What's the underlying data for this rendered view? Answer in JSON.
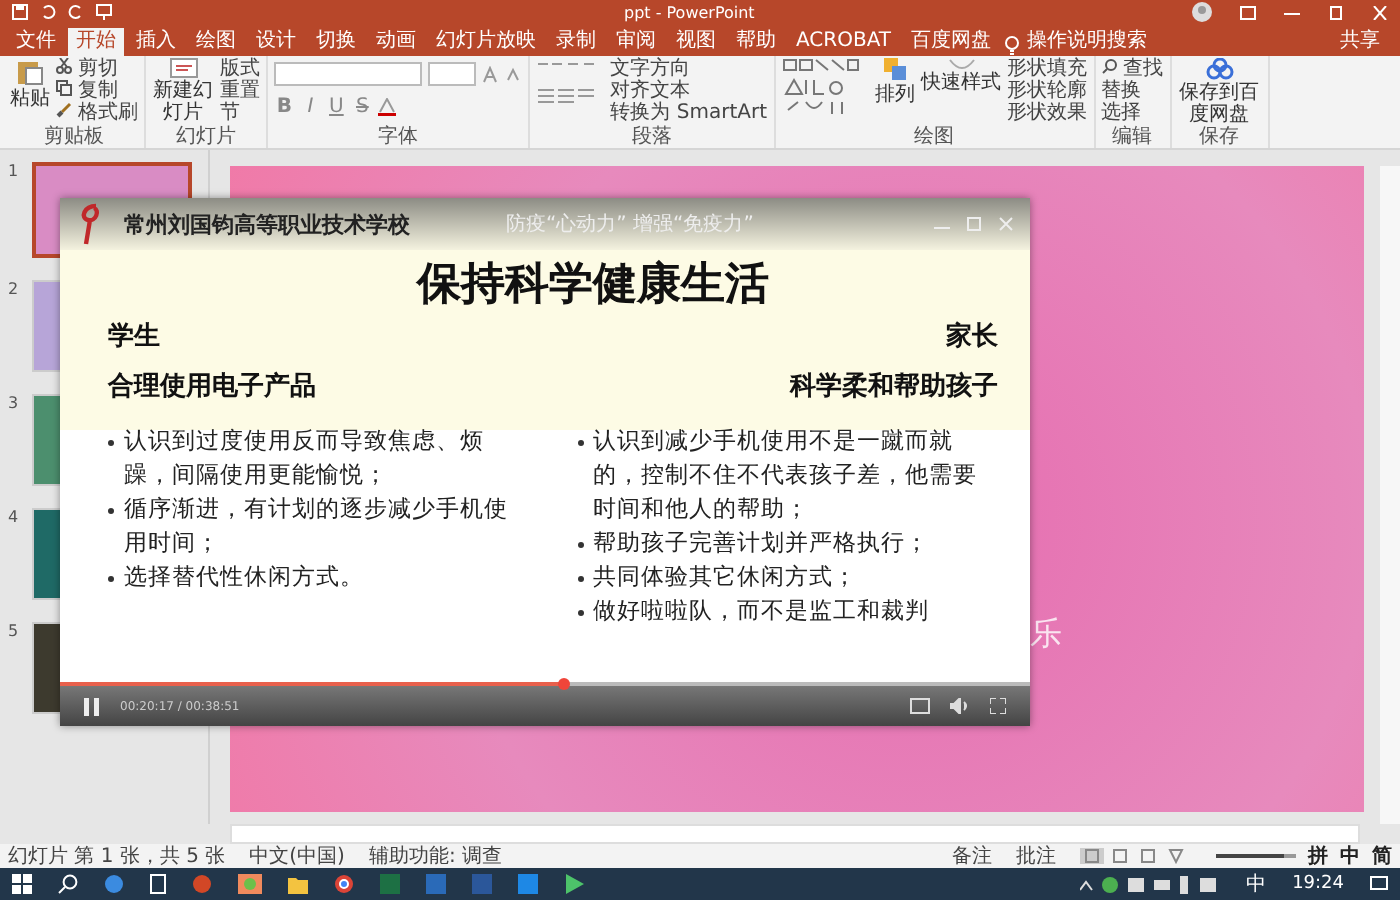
{
  "window": {
    "title": "ppt - PowerPoint"
  },
  "tabs": [
    {
      "label": "文件",
      "selected": false
    },
    {
      "label": "开始",
      "selected": true
    },
    {
      "label": "插入",
      "selected": false
    },
    {
      "label": "绘图",
      "selected": false
    },
    {
      "label": "设计",
      "selected": false
    },
    {
      "label": "切换",
      "selected": false
    },
    {
      "label": "动画",
      "selected": false
    },
    {
      "label": "幻灯片放映",
      "selected": false
    },
    {
      "label": "录制",
      "selected": false
    },
    {
      "label": "审阅",
      "selected": false
    },
    {
      "label": "视图",
      "selected": false
    },
    {
      "label": "帮助",
      "selected": false
    },
    {
      "label": "ACROBAT",
      "selected": false
    },
    {
      "label": "百度网盘",
      "selected": false
    }
  ],
  "tell_me": "操作说明搜索",
  "share": "共享",
  "ribbon": {
    "groups": [
      {
        "kind": "clipboard",
        "label": "剪贴板",
        "buttons": [
          "粘贴",
          "剪切",
          "复制",
          "格式刷"
        ]
      },
      {
        "kind": "slides",
        "label": "幻灯片",
        "buttons": [
          "新建幻灯片",
          "版式",
          "重置",
          "节"
        ]
      },
      {
        "kind": "font",
        "label": "字体",
        "buttons": [
          "B",
          "I",
          "U",
          "S"
        ]
      },
      {
        "kind": "paragraph",
        "label": "段落",
        "buttons": [
          "文字方向",
          "对齐文本",
          "转换为 SmartArt"
        ]
      },
      {
        "kind": "drawing",
        "label": "绘图",
        "buttons": [
          "排列",
          "快速样式",
          "形状填充",
          "形状轮廓",
          "形状效果"
        ]
      },
      {
        "kind": "editing",
        "label": "编辑",
        "buttons": [
          "查找",
          "替换",
          "选择"
        ]
      },
      {
        "kind": "save",
        "label": "保存",
        "buttons": [
          "保存到百度网盘"
        ]
      }
    ]
  },
  "thumbnails": [
    {
      "number": "1",
      "selected": true
    },
    {
      "number": "2",
      "selected": false
    },
    {
      "number": "3",
      "selected": false
    },
    {
      "number": "4",
      "selected": false
    },
    {
      "number": "5",
      "selected": false
    }
  ],
  "slide_text": "乐",
  "video": {
    "school": "常州刘国钧高等职业技术学校",
    "slogan": "防疫“心动力” 增强“免疫力”",
    "title": "保持科学健康生活",
    "left": {
      "heading": "学生",
      "subheading": "合理使用电子产品",
      "bullets": [
        "认识到过度使用反而导致焦虑、烦躁，间隔使用更能愉悦；",
        "循序渐进，有计划的逐步减少手机使用时间；",
        "选择替代性休闲方式。"
      ]
    },
    "right": {
      "heading": "家长",
      "subheading": "科学柔和帮助孩子",
      "bullets": [
        "认识到减少手机使用不是一蹴而就的，控制不住不代表孩子差，他需要时间和他人的帮助；",
        "帮助孩子完善计划并严格执行；",
        "共同体验其它休闲方式；",
        "做好啦啦队，而不是监工和裁判"
      ]
    },
    "progress": {
      "level": 0.52
    },
    "time": "00:20:17 / 00:38:51"
  },
  "status_bar": {
    "slide_info": "幻灯片 第 1 张，共 5 张",
    "language": "中文(中国)",
    "accessibility": "辅助功能: 调查",
    "notes": "备注",
    "comments": "批注",
    "zoom": {
      "level": 0.85
    }
  },
  "ime_bar": [
    "拼",
    "中",
    "简"
  ],
  "taskbar": {
    "ime": "中",
    "time": "19:24"
  }
}
